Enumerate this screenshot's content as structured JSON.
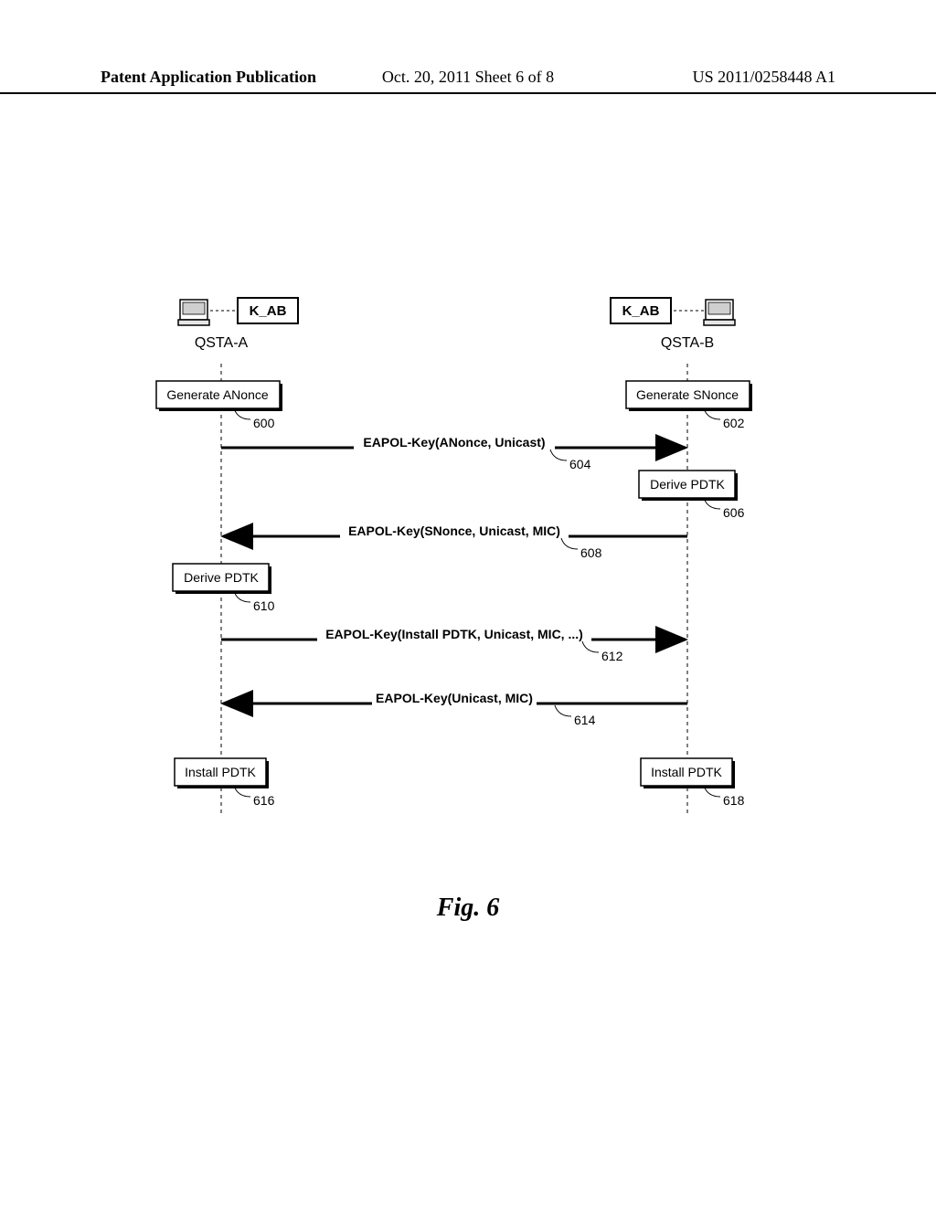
{
  "header": {
    "left": "Patent Application Publication",
    "mid": "Oct. 20, 2011  Sheet 6 of 8",
    "right": "US 2011/0258448 A1"
  },
  "kab_a": "K_AB",
  "kab_b": "K_AB",
  "qsta_a": "QSTA-A",
  "qsta_b": "QSTA-B",
  "a_gen": "Generate ANonce",
  "b_gen": "Generate SNonce",
  "a_derive": "Derive PDTK",
  "b_derive": "Derive PDTK",
  "a_install": "Install PDTK",
  "b_install": "Install PDTK",
  "msg1": "EAPOL-Key(ANonce, Unicast)",
  "msg2": "EAPOL-Key(SNonce, Unicast, MIC)",
  "msg3": "EAPOL-Key(Install PDTK, Unicast, MIC, ...)",
  "msg4": "EAPOL-Key(Unicast, MIC)",
  "r600": "600",
  "r602": "602",
  "r604": "604",
  "r606": "606",
  "r608": "608",
  "r610": "610",
  "r612": "612",
  "r614": "614",
  "r616": "616",
  "r618": "618",
  "fig": "Fig. 6"
}
